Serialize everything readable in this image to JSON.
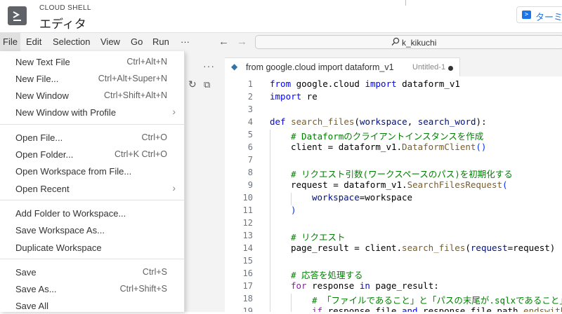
{
  "topbar": {
    "small_title": "CLOUD SHELL",
    "title": "エディタ",
    "terminal_label": "ターミナル"
  },
  "menubar": {
    "items": [
      "File",
      "Edit",
      "Selection",
      "View",
      "Go",
      "Run",
      "···"
    ],
    "active": "File",
    "command_center": "k_kikuchi"
  },
  "file_menu": {
    "items": [
      {
        "label": "New Text File",
        "shortcut": "Ctrl+Alt+N"
      },
      {
        "label": "New File...",
        "shortcut": "Ctrl+Alt+Super+N"
      },
      {
        "label": "New Window",
        "shortcut": "Ctrl+Shift+Alt+N"
      },
      {
        "label": "New Window with Profile",
        "shortcut": ""
      },
      {
        "label": "Open File...",
        "shortcut": "Ctrl+O"
      },
      {
        "label": "Open Folder...",
        "shortcut": "Ctrl+K Ctrl+O"
      },
      {
        "label": "Open Workspace from File...",
        "shortcut": ""
      },
      {
        "label": "Open Recent",
        "shortcut": ""
      },
      {
        "label": "Add Folder to Workspace...",
        "shortcut": ""
      },
      {
        "label": "Save Workspace As...",
        "shortcut": ""
      },
      {
        "label": "Duplicate Workspace",
        "shortcut": ""
      },
      {
        "label": "Save",
        "shortcut": "Ctrl+S"
      },
      {
        "label": "Save As...",
        "shortcut": "Ctrl+Shift+S"
      },
      {
        "label": "Save All",
        "shortcut": ""
      }
    ]
  },
  "sidebar": {
    "more_label": "···"
  },
  "tab": {
    "title": "from google.cloud import dataform_v1",
    "description": "Untitled-1"
  },
  "editor": {
    "line_numbers": [
      "1",
      "2",
      "3",
      "4",
      "5",
      "6",
      "7",
      "8",
      "9",
      "10",
      "11",
      "12",
      "13",
      "14",
      "15",
      "16",
      "17",
      "18",
      "19"
    ],
    "lines": {
      "l1": {
        "a": "from",
        "b": " google.cloud ",
        "c": "import",
        "d": " dataform_v1"
      },
      "l2": {
        "a": "import",
        "b": " re"
      },
      "l4": {
        "a": "def",
        "b": " ",
        "c": "search_files",
        "d": "(",
        "e": "workspace",
        "f": ", ",
        "g": "search_word",
        "h": "):"
      },
      "l5": "# Dataformのクライアントインスタンスを作成",
      "l6": {
        "a": "client = dataform_v1.",
        "b": "DataformClient",
        "c": "()"
      },
      "l8": "# リクエスト引数(ワークスペースのパス)を初期化する",
      "l9": {
        "a": "request = dataform_v1.",
        "b": "SearchFilesRequest",
        "c": "("
      },
      "l10": {
        "a": "workspace",
        "b": "=workspace"
      },
      "l11": ")",
      "l13": "# リクエスト",
      "l14": {
        "a": "page_result = client.",
        "b": "search_files",
        "c": "(",
        "d": "request",
        "e": "=request)"
      },
      "l16": "# 応答を処理する",
      "l17": {
        "a": "for",
        "b": " response ",
        "c": "in",
        "d": " page_result:"
      },
      "l18": "# 「ファイルであること」と「パスの末尾が.sqlxであること」",
      "l19": {
        "a": "if",
        "b": " response.file ",
        "c": "and",
        "d": " response.file.path.",
        "e": "endswith",
        "f": "("
      }
    }
  }
}
